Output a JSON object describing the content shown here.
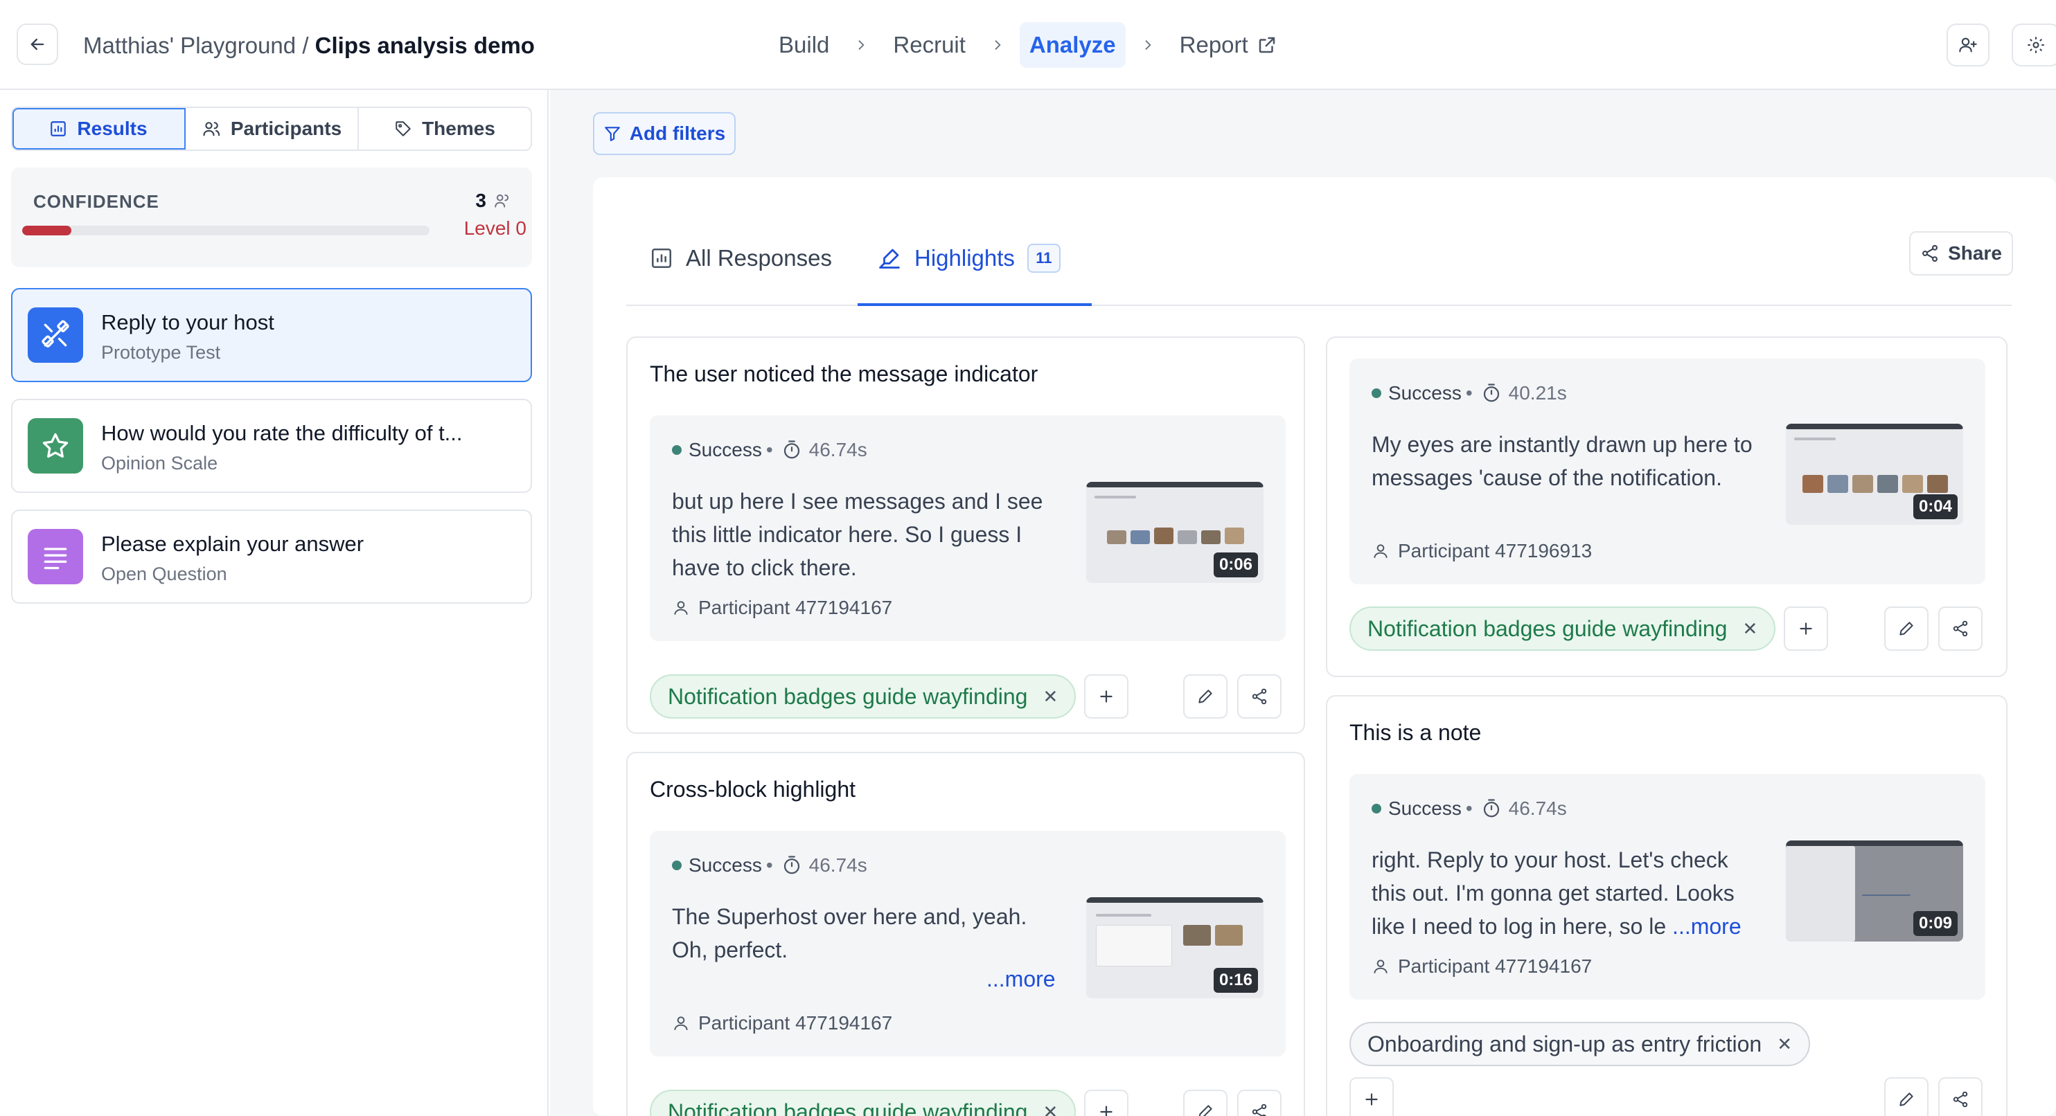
{
  "header": {
    "workspace": "Matthias' Playground",
    "separator": "/",
    "project": "Clips analysis demo",
    "steps": [
      "Build",
      "Recruit",
      "Analyze",
      "Report"
    ],
    "active_step": "Analyze"
  },
  "sidebar": {
    "tabs": [
      "Results",
      "Participants",
      "Themes"
    ],
    "active_tab": "Results",
    "confidence": {
      "label": "CONFIDENCE",
      "count": "3",
      "level": "Level 0",
      "progress_fraction": 0.12
    },
    "questions": [
      {
        "title": "Reply to your host",
        "type": "Prototype Test",
        "icon": "prototype-icon",
        "color": "#2f6fed"
      },
      {
        "title": "How would you rate the difficulty of t...",
        "type": "Opinion Scale",
        "icon": "star-icon",
        "color": "#3f9a6b"
      },
      {
        "title": "Please explain your answer",
        "type": "Open Question",
        "icon": "text-lines-icon",
        "color": "#b26ee6"
      }
    ]
  },
  "main": {
    "filter_label": "Add filters",
    "tabs": {
      "all": "All Responses",
      "highlights": "Highlights",
      "highlights_count": "11"
    },
    "share_label": "Share",
    "cards": [
      {
        "title": "The user noticed the message indicator",
        "status": "Success",
        "duration": "46.74s",
        "quote": "but up here I see messages and I see this little indicator here. So I guess I have to click there.",
        "participant": "Participant 477194167",
        "clip_time": "0:06",
        "tag": "Notification badges guide wayfinding"
      },
      {
        "title": "Cross-block highlight",
        "status": "Success",
        "duration": "46.74s",
        "quote": "The Superhost over here and, yeah. Oh, perfect.",
        "more": "...more",
        "participant": "Participant 477194167",
        "clip_time": "0:16",
        "tag": "Notification badges guide wayfinding"
      },
      {
        "status": "Success",
        "duration": "40.21s",
        "quote": "My eyes are instantly drawn up here to messages 'cause of the notification.",
        "participant": "Participant 477196913",
        "clip_time": "0:04",
        "tag": "Notification badges guide wayfinding"
      },
      {
        "title": "This is a note",
        "status": "Success",
        "duration": "46.74s",
        "quote": "right. Reply to your host. Let's check this out. I'm gonna get started. Looks like I need to log in here, so le",
        "more": "...more",
        "participant": "Participant 477194167",
        "clip_time": "0:09",
        "tag": "Onboarding and sign-up as entry friction"
      }
    ]
  },
  "colors": {
    "accent": "#2563eb",
    "success_dot": "#3d8478",
    "confidence_bar": "#c0343f",
    "tag_green_text": "#1e7a4a"
  }
}
